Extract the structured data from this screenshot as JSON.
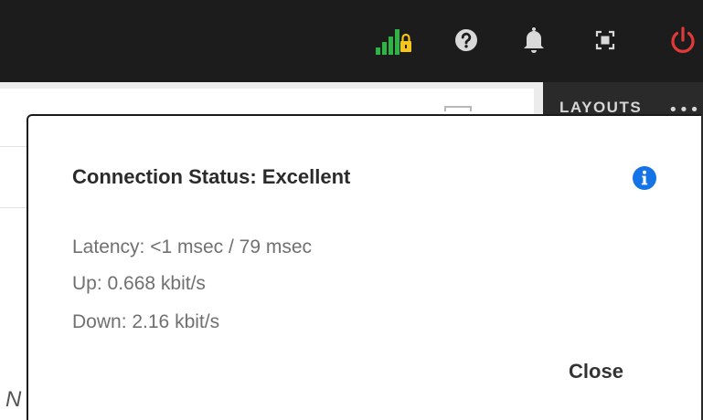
{
  "topbar": {
    "icons": [
      {
        "name": "connection-signal-icon",
        "color": "#2fb344",
        "badge_color": "#f5c518"
      },
      {
        "name": "help-icon",
        "color": "#d9d9d9"
      },
      {
        "name": "notification-bell-icon",
        "color": "#d9d9d9"
      },
      {
        "name": "fullscreen-icon",
        "color": "#d9d9d9"
      },
      {
        "name": "power-icon",
        "color": "#e03a3a"
      }
    ]
  },
  "side_panel": {
    "heading": "LAYOUTS",
    "more": "•••"
  },
  "background": {
    "partial_letter": "N"
  },
  "dialog": {
    "title": "Connection Status: Excellent",
    "info_icon": "info-icon",
    "info_color": "#1473e6",
    "latency": "Latency: <1 msec / 79 msec",
    "up": "Up: 0.668 kbit/s",
    "down": "Down: 2.16 kbit/s",
    "close_label": "Close"
  }
}
